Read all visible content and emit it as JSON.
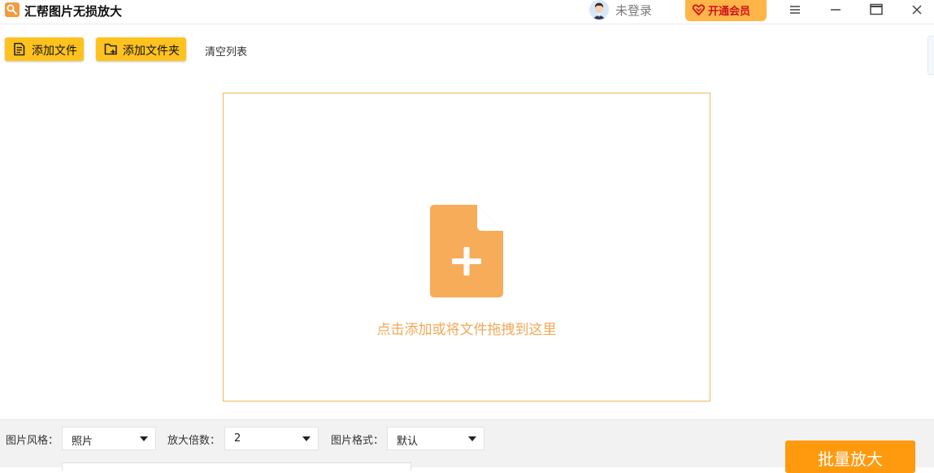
{
  "titlebar": {
    "app_title": "汇帮图片无损放大",
    "login_text": "未登录",
    "vip_label": "开通会员",
    "icons": [
      "app-logo-icon",
      "user-avatar-icon",
      "heart-icon",
      "menu-icon",
      "minimize-icon",
      "maximize-icon",
      "close-icon"
    ]
  },
  "toolbar": {
    "add_file_label": "添加文件",
    "add_folder_label": "添加文件夹",
    "clear_list_label": "清空列表"
  },
  "dropzone": {
    "hint": "点击添加或将文件拖拽到这里",
    "icon": "file-add-icon"
  },
  "options": {
    "style_label": "图片风格：",
    "style_value": "照片",
    "scale_label": "放大倍数：",
    "scale_value": "2",
    "format_label": "图片格式：",
    "format_value": "默认"
  },
  "actions": {
    "batch_label": "批量放大"
  },
  "colors": {
    "accent_yellow": "#ffc21e",
    "accent_orange": "#ff9a0e",
    "dropzone_border": "#f3b35f",
    "drop_text": "#f1a857",
    "vip_bg": "#ffb548",
    "vip_text": "#d0101b"
  }
}
